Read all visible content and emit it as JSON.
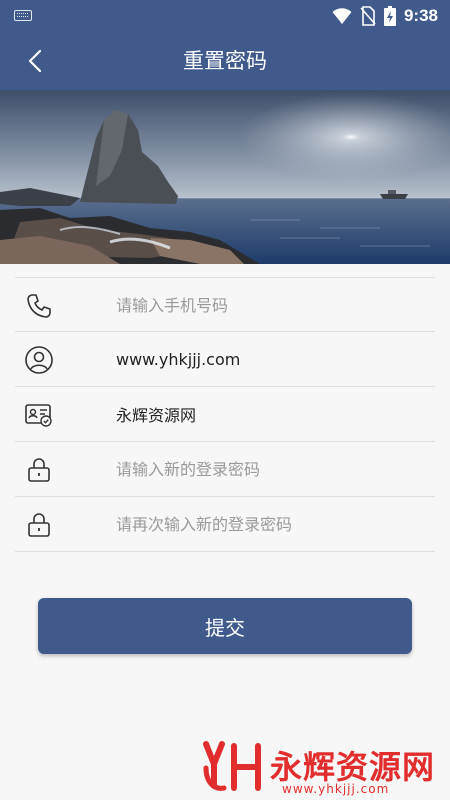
{
  "status_bar": {
    "time": "9:38",
    "icons": [
      "keyboard-icon",
      "wifi-icon",
      "no-sim-icon",
      "battery-charging-icon"
    ]
  },
  "app_bar": {
    "title": "重置密码",
    "back_icon": "chevron-left-icon"
  },
  "form": {
    "phone": {
      "placeholder": "请输入手机号码",
      "value": "",
      "icon": "phone-icon"
    },
    "username": {
      "placeholder": "",
      "value": "www.yhkjjj.com",
      "icon": "user-circle-icon"
    },
    "id_card": {
      "placeholder": "",
      "value": "永辉资源网",
      "icon": "id-card-icon"
    },
    "new_password": {
      "placeholder": "请输入新的登录密码",
      "value": "",
      "icon": "lock-icon"
    },
    "confirm_password": {
      "placeholder": "请再次输入新的登录密码",
      "value": "",
      "icon": "lock-icon"
    }
  },
  "submit_label": "提交",
  "watermark": {
    "name": "永辉资源网",
    "url": "www.yhkjjj.com"
  },
  "colors": {
    "primary": "#3f5a8b",
    "watermark_red": "#e12d2d",
    "background": "#f7f7f7"
  }
}
